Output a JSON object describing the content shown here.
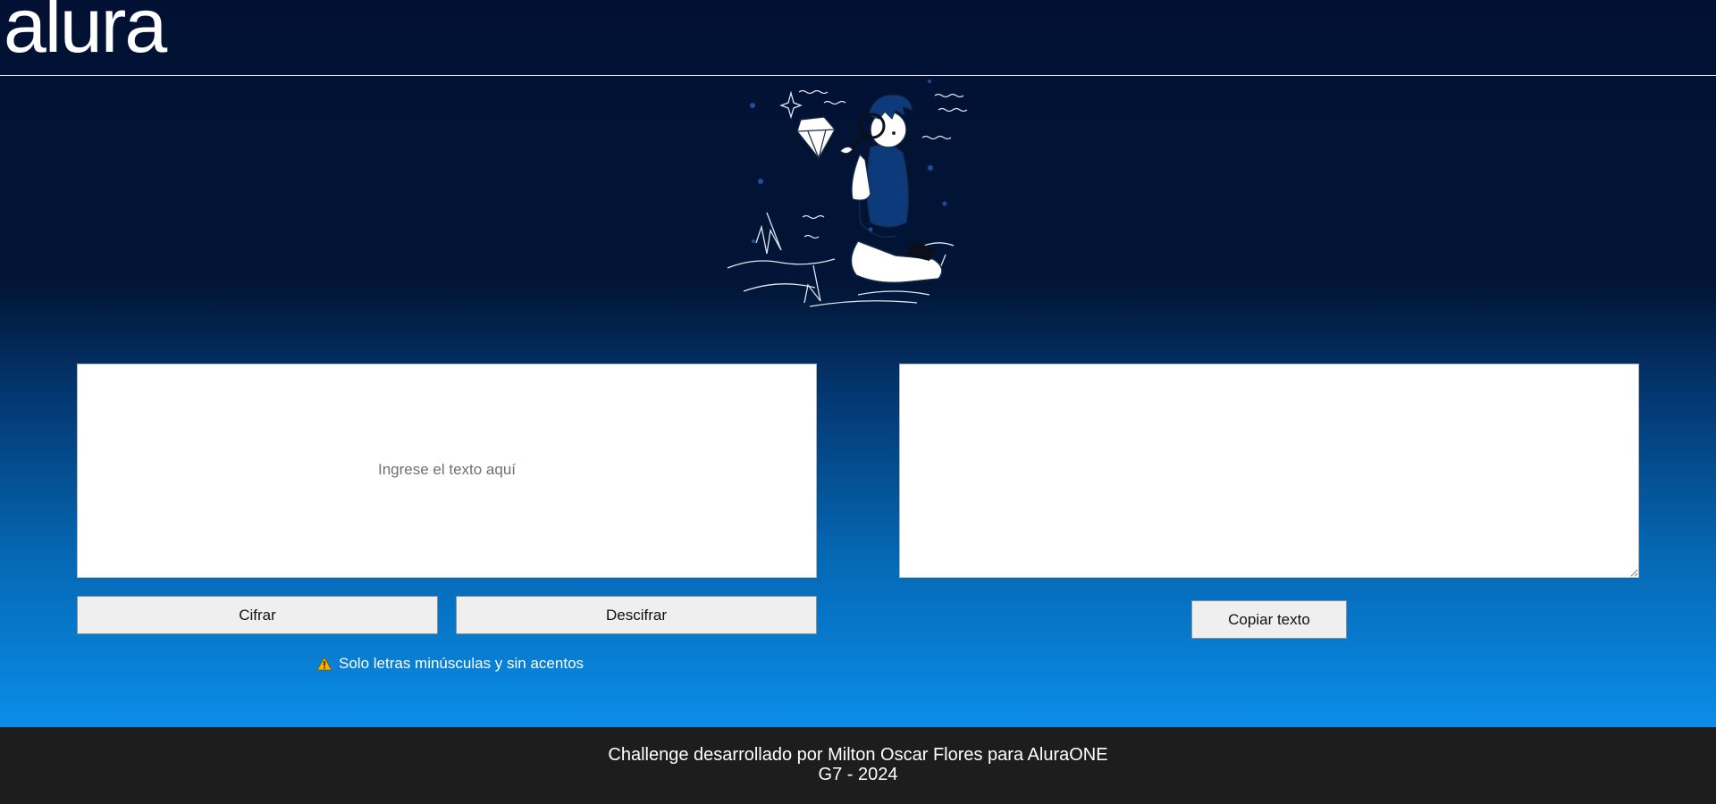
{
  "header": {
    "logo_text": "alura"
  },
  "encrypt_panel": {
    "input_placeholder": "Ingrese el texto aquí",
    "input_value": "",
    "encrypt_label": "Cifrar",
    "decrypt_label": "Descifrar",
    "warning_text": "Solo letras minúsculas y sin acentos",
    "warning_icon": "warning-icon"
  },
  "output_panel": {
    "output_value": "",
    "copy_label": "Copiar texto"
  },
  "footer": {
    "line1": "Challenge desarrollado por Milton Oscar Flores para AluraONE",
    "line2": "G7 - 2024"
  },
  "colors": {
    "page_top": "#021133",
    "page_bottom": "#0a8de8",
    "footer_bg": "#1d1d1d",
    "warning_icon": "#f5b400",
    "illustration_blue": "#0d3a7a"
  }
}
